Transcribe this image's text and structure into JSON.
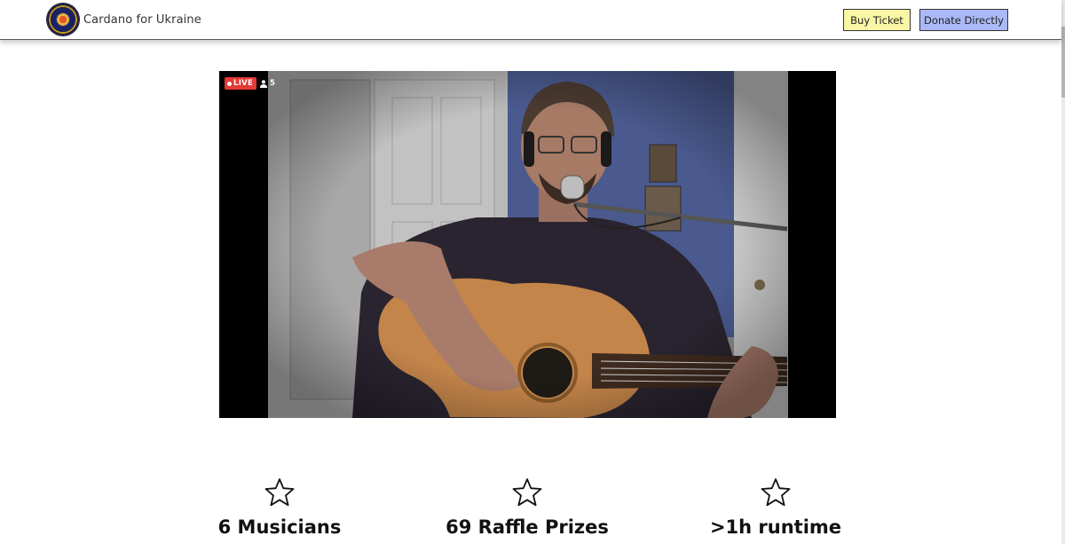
{
  "header": {
    "brand_name": "Cardano for Ukraine",
    "logo_icon": "cardano-for-ukraine-logo",
    "buy_ticket_label": "Buy Ticket",
    "donate_label": "Donate Directly"
  },
  "colors": {
    "buy_ticket_bg": "#f9f7a6",
    "donate_bg": "#aab9f7",
    "live_badge": "#e53935"
  },
  "video": {
    "live_label": "LIVE",
    "viewer_icon": "person-icon",
    "viewer_count": "5"
  },
  "stats": [
    {
      "icon": "star-outline-icon",
      "label": "6 Musicians"
    },
    {
      "icon": "star-outline-icon",
      "label": "69 Raffle Prizes"
    },
    {
      "icon": "star-outline-icon",
      "label": ">1h runtime"
    }
  ]
}
